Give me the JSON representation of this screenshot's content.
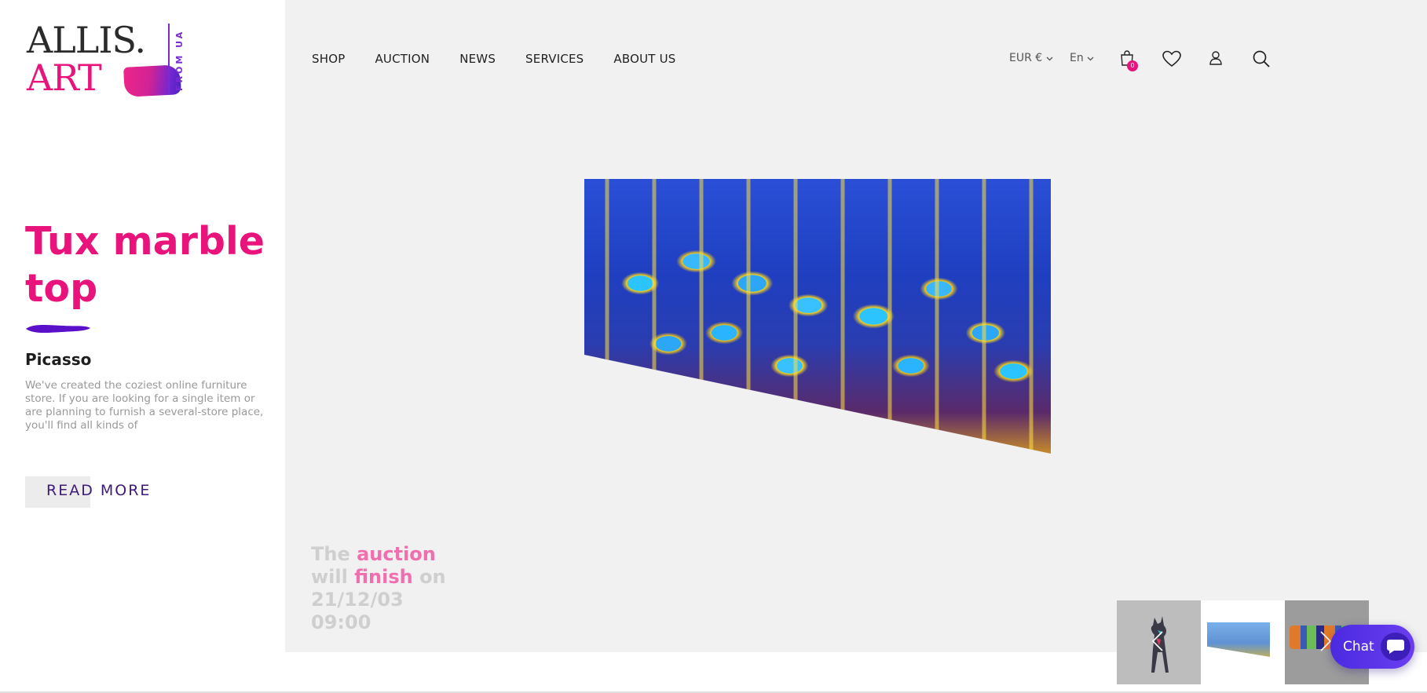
{
  "logo": {
    "line1": "ALLIS.",
    "line2": "ART",
    "tagline": "FROM UA"
  },
  "nav": {
    "items": [
      "SHOP",
      "AUCTION",
      "NEWS",
      "SERVICES",
      "ABOUT US"
    ]
  },
  "header": {
    "currency": "EUR €",
    "language": "En",
    "cart_count": "0"
  },
  "product": {
    "title": "Tux marble top",
    "artist": "Picasso",
    "description": "We've created the coziest online furniture store. If you are looking for a single item or are planning to furnish a several-store place, you'll find all kinds of",
    "read_more": "READ MORE"
  },
  "auction": {
    "w1": "The",
    "w2": "auction",
    "w3": "will",
    "w4": "finish",
    "w5": "on",
    "date": "21/12/03",
    "time": "09:00"
  },
  "chat": {
    "label": "Chat"
  },
  "colors": {
    "accent": "#e8137b",
    "purple": "#3e1a7a",
    "chat": "#5a35e8",
    "hero_bg": "#f1f1f1"
  },
  "icons": [
    "cart-icon",
    "heart-icon",
    "user-icon",
    "search-icon",
    "chevron-down-icon",
    "chevron-left-icon",
    "chevron-right-icon",
    "chat-bubble-icon"
  ]
}
